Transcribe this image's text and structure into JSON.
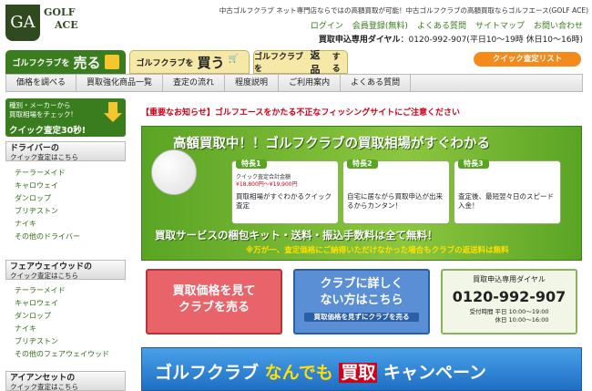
{
  "header": {
    "logo_mark": "GA",
    "logo_text_1": "GOLF",
    "logo_text_2": "ACE",
    "tagline": "中古ゴルフクラブ ネット専門店ならではの高額買取が可能！中古ゴルフクラブの高額買取ならゴルフエース(GOLF ACE)",
    "links": [
      "ログイン",
      "会員登録(無料)",
      "よくある質問",
      "サイトマップ",
      "お問い合わせ"
    ],
    "dial_label": "買取申込専用ダイヤル",
    "dial_text": "：0120-992-907(平日10〜19時 休日10〜16時)"
  },
  "tabs": {
    "sell_prefix": "ゴルフクラブを",
    "sell_big": "売る",
    "buy_prefix": "ゴルフクラブを",
    "buy_big": "買う",
    "return_prefix": "ゴルフクラブを",
    "return_big": "返品",
    "return_suffix": "する"
  },
  "quick_list_label": "クイック査定リスト",
  "nav": [
    "価格を調べる",
    "買取強化商品一覧",
    "査定の流れ",
    "程度説明",
    "ご利用案内",
    "よくある質問"
  ],
  "sidebar": {
    "banner_line1": "種別・メーカーから",
    "banner_line2": "買取相場をチェック!",
    "banner_big": "クイック査定30秒!",
    "categories": [
      {
        "title": "ドライバーの",
        "sub": "クイック査定はこちら",
        "items": [
          "テーラーメイド",
          "キャロウェイ",
          "ダンロップ",
          "ブリヂストン",
          "ナイキ",
          "その他のドライバー"
        ]
      },
      {
        "title": "フェアウェイウッドの",
        "sub": "クイック査定はこちら",
        "items": [
          "テーラーメイド",
          "キャロウェイ",
          "ダンロップ",
          "ナイキ",
          "ブリヂストン",
          "その他のフェアウェイウッド"
        ]
      },
      {
        "title": "アイアンセットの",
        "sub": "クイック査定はこちら",
        "items": []
      }
    ]
  },
  "warning": "【重要なお知らせ】ゴルフエースをかたる不正なフィッシングサイトにご注意ください",
  "hero": {
    "title": "高額買取中！！ゴルフクラブの買取相場がすぐわかる",
    "features": [
      {
        "tag": "特長1",
        "small1": "クイック査定合計金額",
        "small2": "¥18,800円〜¥19,900円",
        "text": "買取相場がすぐわかるクイック査定"
      },
      {
        "tag": "特長2",
        "text": "自宅に居ながら買取申込が出来るからカンタン！"
      },
      {
        "tag": "特長3",
        "text": "査定後、最短翌々日のスピード入金！"
      }
    ],
    "sub": "買取サービスの梱包キット・送料・振込手数料は全て無料！",
    "sub2": "※万が一、査定価格にご納得いただけなかった場合もクラブの返送料は無料"
  },
  "buttons": {
    "red": "買取価格を見てクラブを売る",
    "red_l1": "買取価格を見て",
    "red_l2": "クラブを売る",
    "blue_l1": "クラブに詳しく",
    "blue_l2": "ない方はこちら",
    "blue_sub": "買取価格を見ずにクラブを売る"
  },
  "dialbox": {
    "heading": "買取申込専用ダイヤル",
    "number": "0120-992-907",
    "hours_label": "受付時間",
    "weekday": "平日 10:00〜19:00",
    "holiday": "休日 10:00〜16:00"
  },
  "campaign": {
    "part1": "ゴルフクラブ",
    "part2": "なんでも",
    "part3": "買取",
    "part4": "キャンペーン"
  },
  "colors": {
    "brand_green": "#3a7d1e",
    "accent_orange": "#f28a1c",
    "warning_red": "#d0021b"
  }
}
